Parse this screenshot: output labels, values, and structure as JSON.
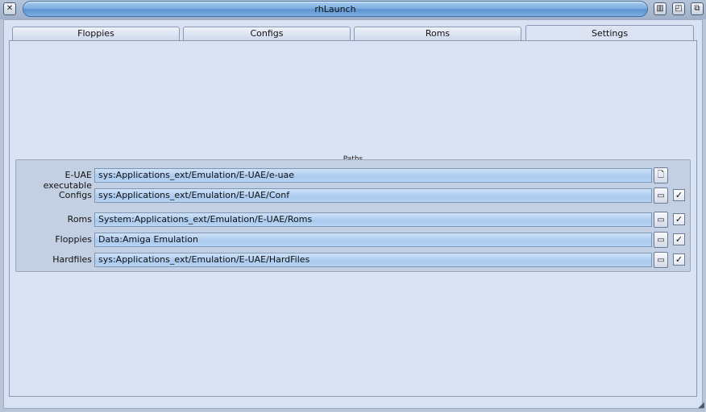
{
  "window": {
    "title": "rhLaunch"
  },
  "titlebar_icons": {
    "close": "close-icon",
    "iconify": "iconify-icon",
    "zoom": "zoom-icon",
    "depth": "depth-icon"
  },
  "tabs": [
    {
      "label": "Floppies",
      "active": false
    },
    {
      "label": "Configs",
      "active": false
    },
    {
      "label": "Roms",
      "active": false
    },
    {
      "label": "Settings",
      "active": true
    }
  ],
  "paths": {
    "group_title": "Paths",
    "rows": [
      {
        "label": "E-UAE executable",
        "value": "sys:Applications_ext/Emulation/E-UAE/e-uae",
        "button_icon": "file-icon",
        "has_check": false
      },
      {
        "label": "Configs",
        "value": "sys:Applications_ext/Emulation/E-UAE/Conf",
        "button_icon": "folder-icon",
        "has_check": true,
        "checked": true
      },
      {
        "label": "Roms",
        "value": "System:Applications_ext/Emulation/E-UAE/Roms",
        "button_icon": "folder-icon",
        "has_check": true,
        "checked": true
      },
      {
        "label": "Floppies",
        "value": "Data:Amiga Emulation",
        "button_icon": "folder-icon",
        "has_check": true,
        "checked": true
      },
      {
        "label": "Hardfiles",
        "value": "sys:Applications_ext/Emulation/E-UAE/HardFiles",
        "button_icon": "folder-icon",
        "has_check": true,
        "checked": true
      }
    ]
  },
  "colors": {
    "title_accent": "#7fb1e3",
    "panel_bg": "#dae3f3",
    "field_bg": "#b9d5f3"
  }
}
